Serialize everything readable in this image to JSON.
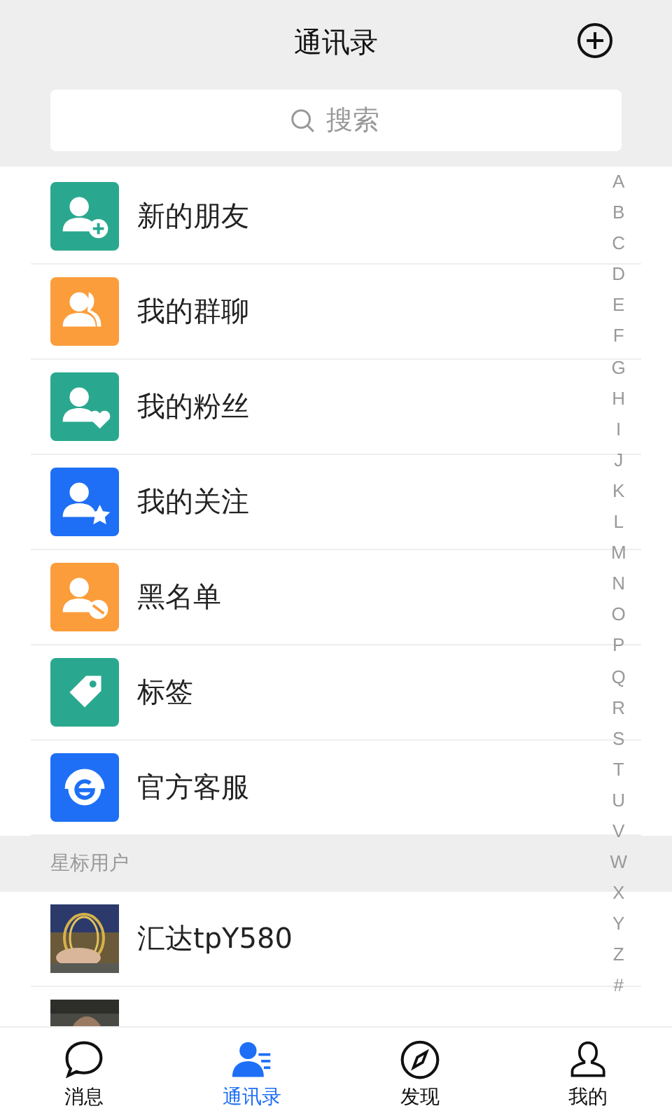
{
  "header": {
    "title": "通讯录"
  },
  "search": {
    "placeholder": "搜索"
  },
  "menu": [
    {
      "label": "新的朋友",
      "kind": "add",
      "color": "#2aa88f"
    },
    {
      "label": "我的群聊",
      "kind": "group",
      "color": "#fb9d3b"
    },
    {
      "label": "我的粉丝",
      "kind": "heart",
      "color": "#2aa88f"
    },
    {
      "label": "我的关注",
      "kind": "star",
      "color": "#1e6ff5"
    },
    {
      "label": "黑名单",
      "kind": "block",
      "color": "#fb9d3b"
    },
    {
      "label": "标签",
      "kind": "tag",
      "color": "#2aa88f"
    },
    {
      "label": "官方客服",
      "kind": "service",
      "color": "#1e6ff5"
    }
  ],
  "section": {
    "title": "星标用户"
  },
  "contacts": [
    {
      "name": "汇达tpY580",
      "avatar": {
        "kind": "picture"
      }
    },
    {
      "avatar": {
        "kind": "picture"
      }
    }
  ],
  "index": [
    "A",
    "B",
    "C",
    "D",
    "E",
    "F",
    "G",
    "H",
    "I",
    "J",
    "K",
    "L",
    "M",
    "N",
    "O",
    "P",
    "Q",
    "R",
    "S",
    "T",
    "U",
    "V",
    "W",
    "X",
    "Y",
    "Z",
    "#"
  ],
  "tabs": [
    {
      "label": "消息",
      "kind": "chat",
      "selected": false
    },
    {
      "label": "通讯录",
      "kind": "contacts",
      "selected": true
    },
    {
      "label": "发现",
      "kind": "compass",
      "selected": false
    },
    {
      "label": "我的",
      "kind": "person",
      "selected": false
    }
  ]
}
